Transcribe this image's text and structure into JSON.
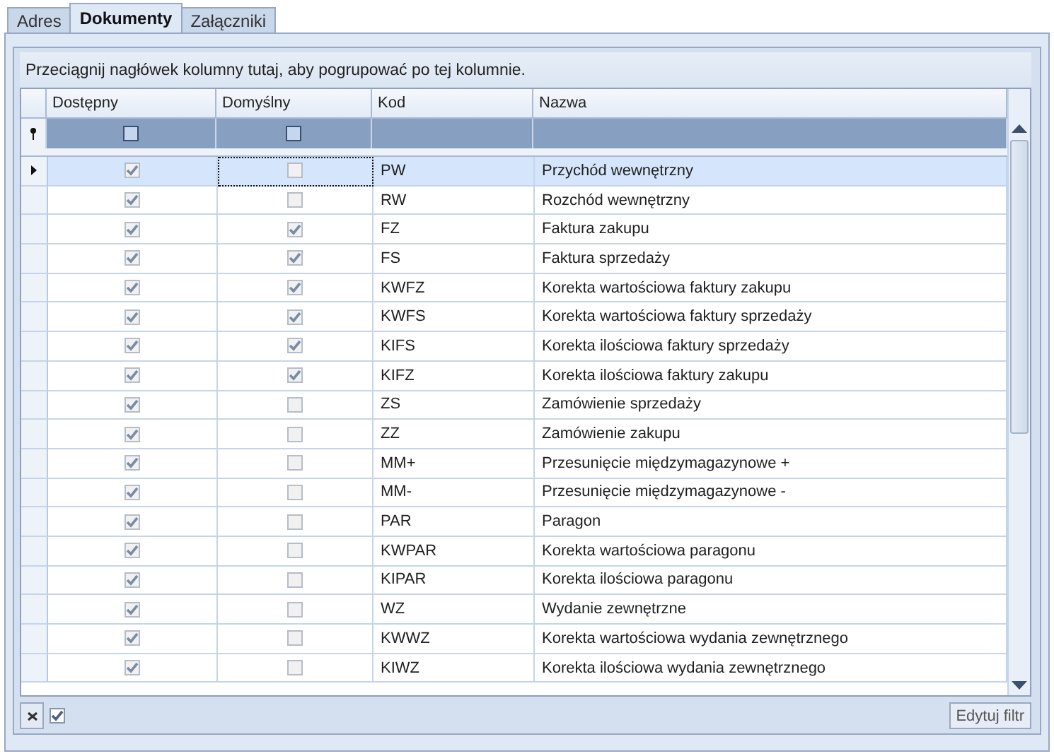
{
  "tabs": [
    {
      "label": "Adres",
      "selected": false
    },
    {
      "label": "Dokumenty",
      "selected": true
    },
    {
      "label": "Załączniki",
      "selected": false
    }
  ],
  "group_panel": {
    "hint": "Przeciągnij nagłówek kolumny tutaj, aby pogrupować po tej kolumnie."
  },
  "table": {
    "columns": [
      "Dostępny",
      "Domyślny",
      "Kod",
      "Nazwa"
    ],
    "filter_row": {
      "available_checked": false,
      "default_checked": false
    },
    "rows": [
      {
        "available": true,
        "default": false,
        "code": "PW",
        "name": "Przychód wewnętrzny",
        "selected": true
      },
      {
        "available": true,
        "default": false,
        "code": "RW",
        "name": "Rozchód wewnętrzny",
        "selected": false
      },
      {
        "available": true,
        "default": true,
        "code": "FZ",
        "name": "Faktura zakupu",
        "selected": false
      },
      {
        "available": true,
        "default": true,
        "code": "FS",
        "name": "Faktura sprzedaży",
        "selected": false
      },
      {
        "available": true,
        "default": true,
        "code": "KWFZ",
        "name": "Korekta wartościowa faktury zakupu",
        "selected": false
      },
      {
        "available": true,
        "default": true,
        "code": "KWFS",
        "name": "Korekta wartościowa faktury sprzedaży",
        "selected": false
      },
      {
        "available": true,
        "default": true,
        "code": "KIFS",
        "name": "Korekta ilościowa faktury sprzedaży",
        "selected": false
      },
      {
        "available": true,
        "default": true,
        "code": "KIFZ",
        "name": "Korekta ilościowa faktury zakupu",
        "selected": false
      },
      {
        "available": true,
        "default": false,
        "code": "ZS",
        "name": "Zamówienie sprzedaży",
        "selected": false
      },
      {
        "available": true,
        "default": false,
        "code": "ZZ",
        "name": "Zamówienie zakupu",
        "selected": false
      },
      {
        "available": true,
        "default": false,
        "code": "MM+",
        "name": "Przesunięcie międzymagazynowe +",
        "selected": false
      },
      {
        "available": true,
        "default": false,
        "code": "MM-",
        "name": "Przesunięcie międzymagazynowe -",
        "selected": false
      },
      {
        "available": true,
        "default": false,
        "code": "PAR",
        "name": "Paragon",
        "selected": false
      },
      {
        "available": true,
        "default": false,
        "code": "KWPAR",
        "name": "Korekta wartościowa paragonu",
        "selected": false
      },
      {
        "available": true,
        "default": false,
        "code": "KIPAR",
        "name": "Korekta ilościowa paragonu",
        "selected": false
      },
      {
        "available": true,
        "default": false,
        "code": "WZ",
        "name": "Wydanie zewnętrzne",
        "selected": false
      },
      {
        "available": true,
        "default": false,
        "code": "KWWZ",
        "name": "Korekta wartościowa wydania zewnętrznego",
        "selected": false
      },
      {
        "available": true,
        "default": false,
        "code": "KIWZ",
        "name": "Korekta ilościowa wydania zewnętrznego",
        "selected": false
      }
    ]
  },
  "filter_bar": {
    "enabled": true,
    "button": "Edytuj filtr"
  }
}
